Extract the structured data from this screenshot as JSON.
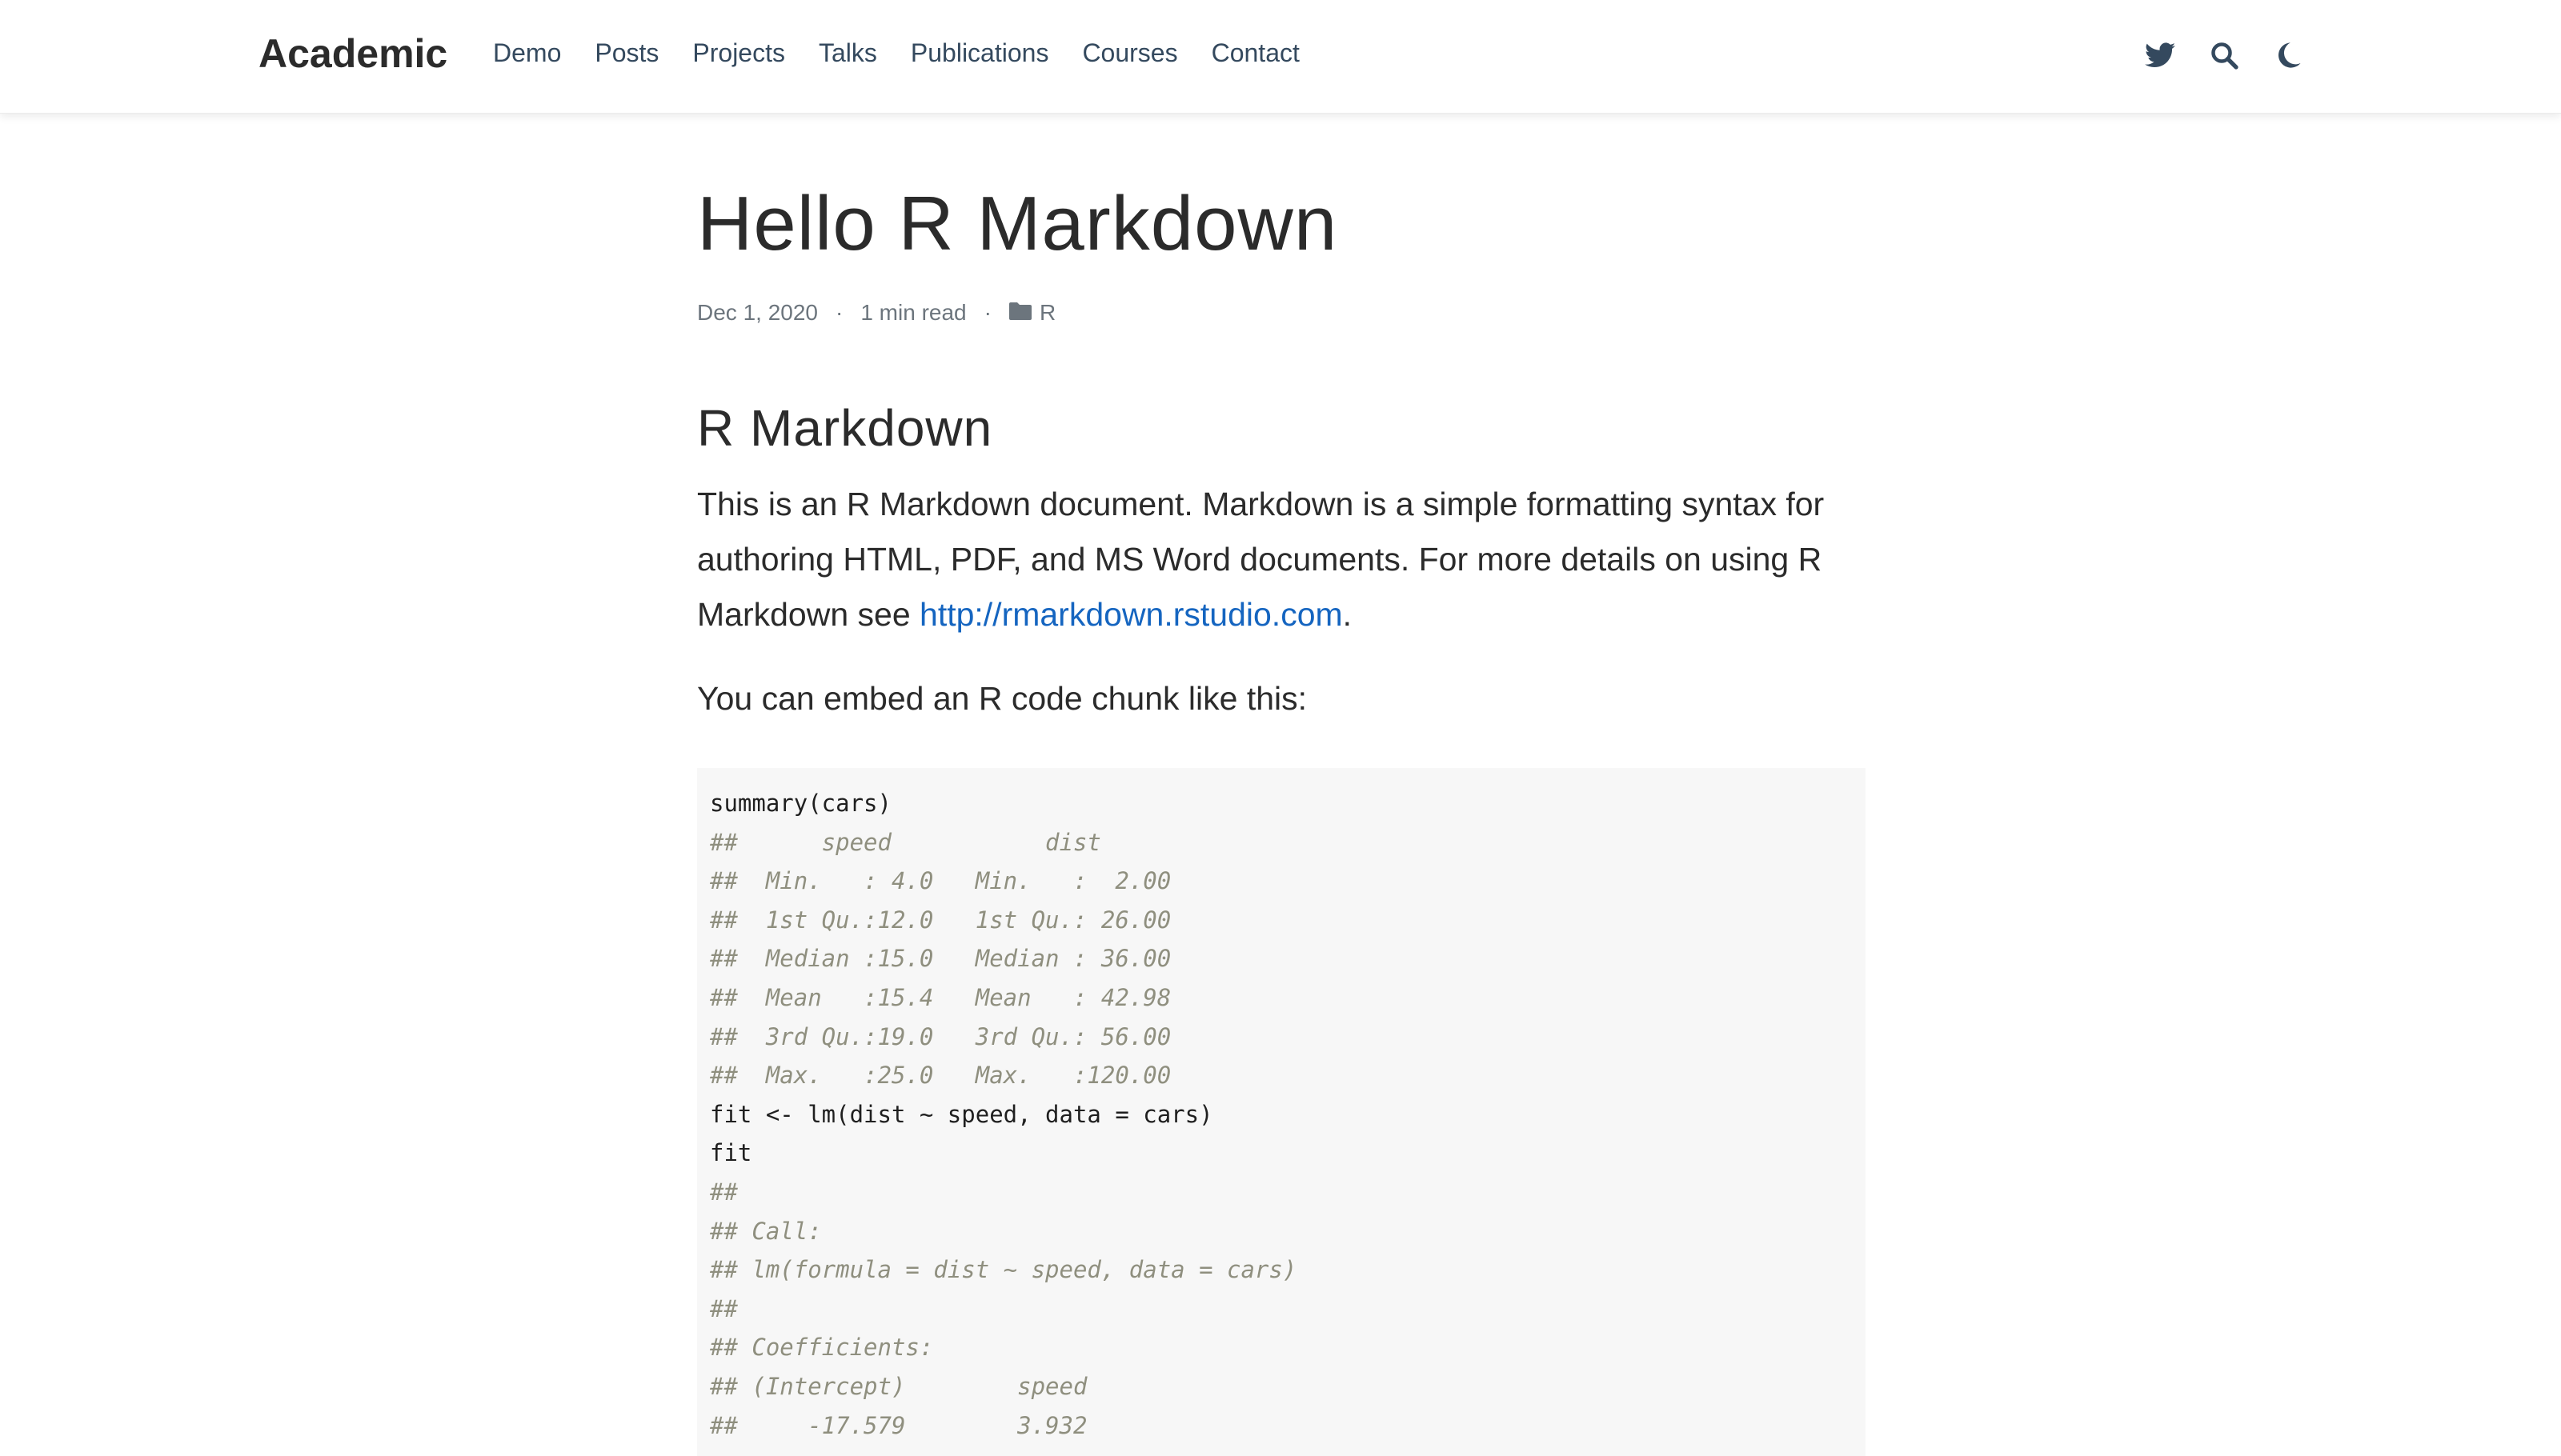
{
  "nav": {
    "logo": "Academic",
    "items": [
      "Demo",
      "Posts",
      "Projects",
      "Talks",
      "Publications",
      "Courses",
      "Contact"
    ],
    "icons": [
      "twitter-icon",
      "search-icon",
      "moon-icon"
    ]
  },
  "post": {
    "title": "Hello R Markdown",
    "date": "Dec 1, 2020",
    "read_time": "1 min read",
    "category": "R",
    "heading": "R Markdown",
    "para1_text": "This is an R Markdown document. Markdown is a simple formatting syntax for authoring HTML, PDF, and MS Word documents. For more details on using R Markdown see ",
    "para1_link": "http://rmarkdown.rstudio.com",
    "para1_end": ".",
    "para2": "You can embed an R code chunk like this:",
    "code": [
      {
        "t": "src",
        "text": "summary(cars)"
      },
      {
        "t": "out",
        "text": "##      speed           dist       "
      },
      {
        "t": "out",
        "text": "##  Min.   : 4.0   Min.   :  2.00  "
      },
      {
        "t": "out",
        "text": "##  1st Qu.:12.0   1st Qu.: 26.00  "
      },
      {
        "t": "out",
        "text": "##  Median :15.0   Median : 36.00  "
      },
      {
        "t": "out",
        "text": "##  Mean   :15.4   Mean   : 42.98  "
      },
      {
        "t": "out",
        "text": "##  3rd Qu.:19.0   3rd Qu.: 56.00  "
      },
      {
        "t": "out",
        "text": "##  Max.   :25.0   Max.   :120.00  "
      },
      {
        "t": "src",
        "text": "fit <- lm(dist ~ speed, data = cars)"
      },
      {
        "t": "src",
        "text": "fit"
      },
      {
        "t": "out",
        "text": "## "
      },
      {
        "t": "out",
        "text": "## Call:"
      },
      {
        "t": "out",
        "text": "## lm(formula = dist ~ speed, data = cars)"
      },
      {
        "t": "out",
        "text": "## "
      },
      {
        "t": "out",
        "text": "## Coefficients:"
      },
      {
        "t": "out",
        "text": "## (Intercept)        speed  "
      },
      {
        "t": "out",
        "text": "##     -17.579        3.932  "
      }
    ]
  },
  "colors": {
    "link": "#1565c0",
    "nav_text": "#34495e",
    "code_bg": "#f7f7f7",
    "comment": "#8f8f7f"
  }
}
